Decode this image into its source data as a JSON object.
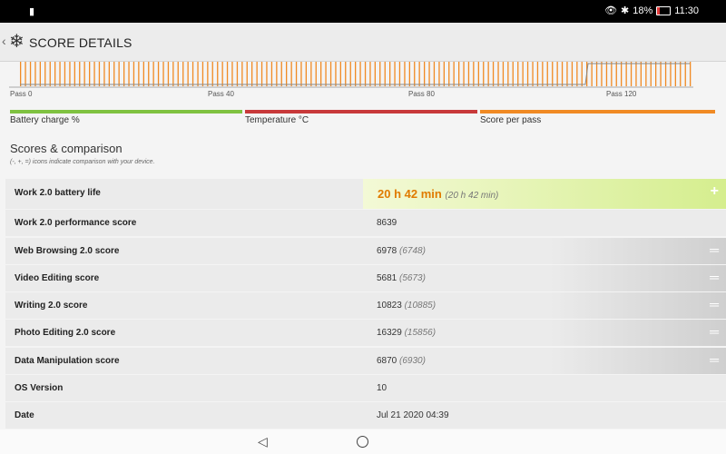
{
  "status_bar": {
    "left_icon": "battery-saver-icon",
    "battery_percent": "18%",
    "battery_level": 0.18,
    "time": "11:30",
    "icons": [
      "eye-icon",
      "bluetooth-icon"
    ]
  },
  "app_bar": {
    "title": "SCORE DETAILS",
    "back_icon": "chevron-left-icon",
    "logo_icon": "snowflake-icon"
  },
  "chart_data": {
    "type": "bar",
    "x_tick_labels": [
      "Pass 0",
      "Pass 40",
      "Pass 80",
      "Pass 120"
    ],
    "x": [
      0,
      40,
      80,
      120
    ],
    "bar_color": "#f08a24",
    "legend": [
      {
        "label": "Battery charge %",
        "color": "#7fc241"
      },
      {
        "label": "Temperature °C",
        "color": "#c8393a"
      },
      {
        "label": "Score per pass",
        "color": "#f08a24"
      }
    ]
  },
  "scores": {
    "title": "Scores & comparison",
    "subtitle": "(-, +, =) icons indicate comparison with your device.",
    "rows": [
      {
        "label": "Work 2.0 battery life",
        "value": "20 h 42 min",
        "compare": "(20 h 42 min)",
        "icon": "plus-icon"
      },
      {
        "label": "Work 2.0 performance score",
        "value": "8639",
        "compare": "",
        "icon": ""
      },
      {
        "label": "Web Browsing 2.0 score",
        "value": "6978",
        "compare": "(6748)",
        "icon": "equals-icon"
      },
      {
        "label": "Video Editing score",
        "value": "5681",
        "compare": "(5673)",
        "icon": "equals-icon"
      },
      {
        "label": "Writing 2.0 score",
        "value": "10823",
        "compare": "(10885)",
        "icon": "equals-icon"
      },
      {
        "label": "Photo Editing 2.0 score",
        "value": "16329",
        "compare": "(15856)",
        "icon": "equals-icon"
      },
      {
        "label": "Data Manipulation score",
        "value": "6870",
        "compare": "(6930)",
        "icon": "equals-icon"
      },
      {
        "label": "OS Version",
        "value": "10",
        "compare": "",
        "icon": ""
      },
      {
        "label": "Date",
        "value": "Jul 21 2020 04:39",
        "compare": "",
        "icon": ""
      }
    ]
  },
  "nav_bar": {
    "back_icon": "triangle-back-icon",
    "home_icon": "circle-home-icon"
  }
}
